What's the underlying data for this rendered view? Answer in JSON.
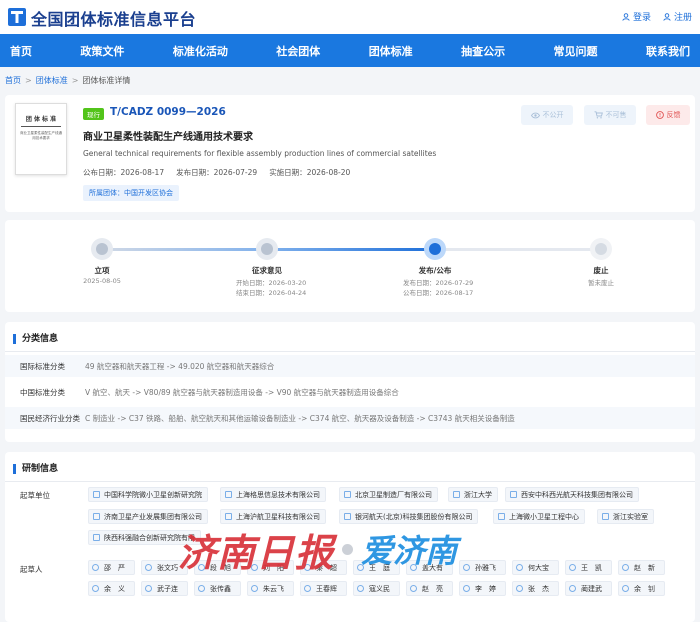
{
  "header": {
    "site_title": "全国团体标准信息平台",
    "login": "登录",
    "register": "注册"
  },
  "nav": [
    "首页",
    "政策文件",
    "标准化活动",
    "社会团体",
    "团体标准",
    "抽查公示",
    "常见问题",
    "联系我们"
  ],
  "breadcrumb": {
    "home": "首页",
    "section": "团体标准",
    "current": "团体标准详情"
  },
  "standard": {
    "status": "现行",
    "code": "T/CADZ 0099—2026",
    "title": "商业卫星柔性装配生产线通用技术要求",
    "title_en": "General technical requirements for flexible assembly production lines of commercial satellites",
    "publish_date_label": "公布日期：",
    "publish_date": "2026-08-17",
    "release_date_label": "发布日期：",
    "release_date": "2026-07-29",
    "implement_date_label": "实施日期：",
    "implement_date": "2026-08-20",
    "org": "所属团体：中国开发区协会",
    "cover": {
      "title": "团 体 标 准",
      "subtitle": "商业卫星柔性装配生产线通用技术要求"
    },
    "actions": {
      "private": "不公开",
      "not_for_sale": "不可售",
      "feedback": "反馈"
    }
  },
  "timeline": {
    "steps": [
      {
        "label": "立项",
        "lines": [
          "2025-08-05"
        ]
      },
      {
        "label": "征求意见",
        "lines": [
          "开始日期：2026-03-20",
          "结束日期：2026-04-24"
        ]
      },
      {
        "label": "发布/公布",
        "lines": [
          "发布日期：2026-07-29",
          "公布日期：2026-08-17"
        ]
      },
      {
        "label": "废止",
        "lines": [
          "暂未废止"
        ]
      }
    ],
    "current_step": 2
  },
  "classification": {
    "title": "分类信息",
    "rows": [
      {
        "label": "国际标准分类",
        "value": "49 航空器和航天器工程 -> 49.020 航空器和航天器综合"
      },
      {
        "label": "中国标准分类",
        "value": "V 航空、航天 -> V80/89 航空器与航天器制造用设备 -> V90 航空器与航天器制造用设备综合"
      },
      {
        "label": "国民经济行业分类",
        "value": "C 制造业 -> C37 铁路、船舶、航空航天和其他运输设备制造业 -> C374 航空、航天器及设备制造 -> C3743 航天相关设备制造"
      }
    ]
  },
  "drafting": {
    "title": "研制信息",
    "units_label": "起草单位",
    "units": [
      "中国科学院微小卫星创新研究院",
      "上海格思信息技术有限公司",
      "北京卫星制造厂有限公司",
      "浙江大学",
      "西安中科西光航天科技集团有限公司",
      "济南卫星产业发展集团有限公司",
      "上海沪航卫星科技有限公司",
      "银河航天(北京)科技集团股份有限公司",
      "上海微小卫星工程中心",
      "浙江实验室",
      "陕西科强融合创新研究院有限"
    ],
    "people_label": "起草人",
    "people": [
      "邵　严",
      "张文巧",
      "段　旭",
      "刘　阳",
      "秦　超",
      "王　庭",
      "盖大有",
      "孙雅飞",
      "何大宝",
      "王　凯",
      "赵　新",
      "余　义",
      "武子连",
      "张传鑫",
      "朱云飞",
      "王春辉",
      "寇义民",
      "赵　亮",
      "李　婷",
      "张　杰",
      "蔺建武",
      "余　钊"
    ]
  },
  "watermark": {
    "left": "济南日报",
    "right": "爱济南"
  },
  "colors": {
    "primary": "#1a78e0",
    "title": "#1a3f8f",
    "status_green": "#52c41a",
    "feedback_red": "#e05252"
  }
}
